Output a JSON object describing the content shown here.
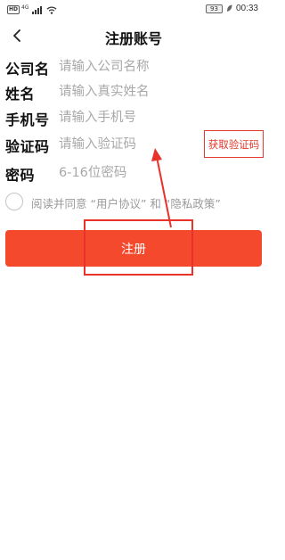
{
  "status_bar": {
    "network_badge": "HD",
    "network_type": "4G",
    "battery": "93",
    "time": "00:33",
    "icons": [
      "hd-icon",
      "signal-icon",
      "wifi-icon",
      "battery-icon",
      "leaf-icon"
    ]
  },
  "nav": {
    "back_icon": "chevron-left-icon",
    "title": "注册账号"
  },
  "form": {
    "company": {
      "label": "公司名",
      "placeholder": "请输入公司名称",
      "value": ""
    },
    "name": {
      "label": "姓名",
      "placeholder": "请输入真实姓名",
      "value": ""
    },
    "phone": {
      "label": "手机号",
      "placeholder": "请输入手机号",
      "value": ""
    },
    "code": {
      "label": "验证码",
      "placeholder": "请输入验证码",
      "value": ""
    },
    "password": {
      "label": "密码",
      "placeholder": "6-16位密码",
      "value": ""
    }
  },
  "get_code_button": "获取验证码",
  "agreement": {
    "text": "阅读并同意 “用户协议” 和 “隐私政策”",
    "checked": false
  },
  "register_button": "注册",
  "colors": {
    "accent": "#f5492e",
    "annotation": "#e8322a",
    "placeholder": "#a8a8a8"
  }
}
